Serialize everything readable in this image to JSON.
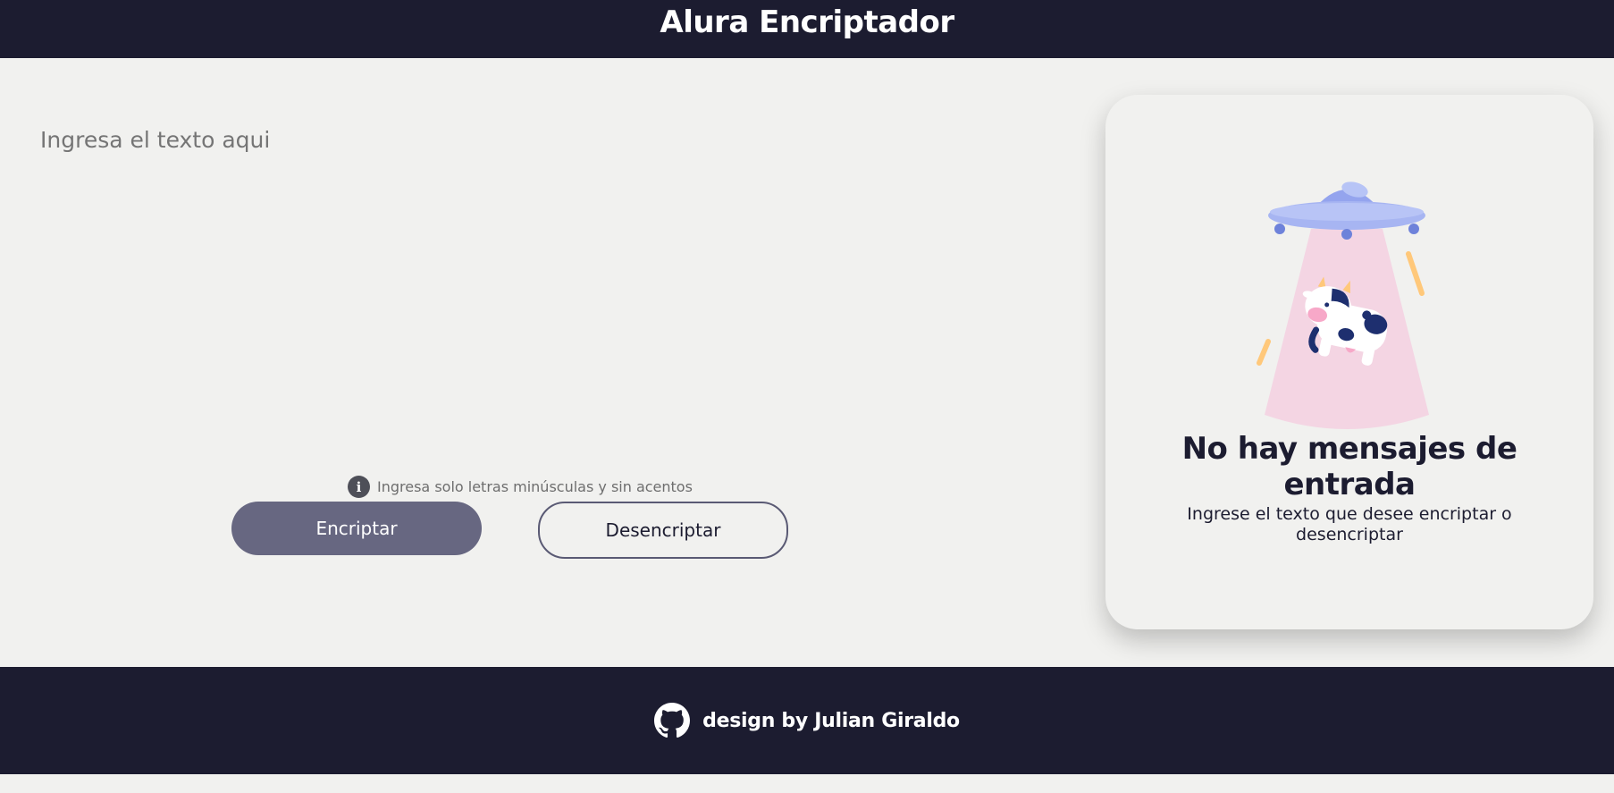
{
  "header": {
    "title": "Alura Encriptador"
  },
  "input": {
    "placeholder": "Ingresa el texto aqui",
    "value": ""
  },
  "hint": {
    "icon": "info-icon",
    "icon_glyph": "i",
    "text": "Ingresa solo letras minúsculas y sin acentos"
  },
  "buttons": {
    "encrypt_label": "Encriptar",
    "decrypt_label": "Desencriptar"
  },
  "output_panel": {
    "illustration": "ufo-abducting-cow-illustration",
    "title": "No hay mensajes de entrada",
    "subtitle": "Ingrese el texto que desee encriptar o desencriptar"
  },
  "footer": {
    "icon": "github-icon",
    "text": "design by Julian Giraldo"
  },
  "colors": {
    "dark": "#1c1c30",
    "background": "#f1f1ef",
    "button_primary": "#676781",
    "button_border": "#5a5a74"
  }
}
